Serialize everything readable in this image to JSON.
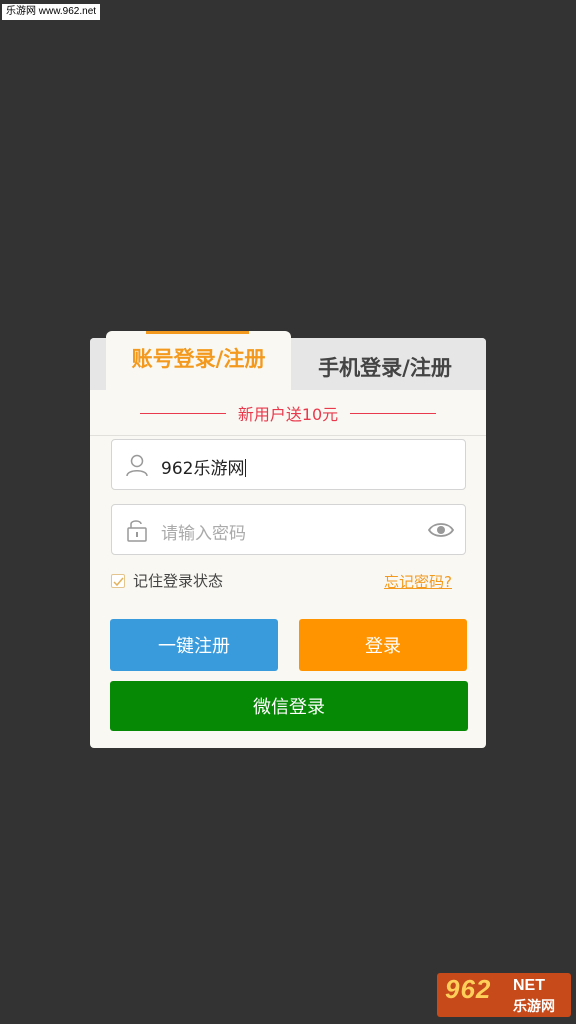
{
  "watermark_top": "乐游网 www.962.net",
  "tabs": {
    "account": "账号登录/注册",
    "phone": "手机登录/注册"
  },
  "promo": "新用户送10元",
  "username": {
    "value": "962乐游网",
    "icon": "user-icon"
  },
  "password": {
    "placeholder": "请输入密码",
    "icon": "lock-icon",
    "toggle_icon": "eye-icon"
  },
  "remember": {
    "label": "记住登录状态",
    "checked": true
  },
  "forgot": "忘记密码?",
  "buttons": {
    "register": "一键注册",
    "login": "登录",
    "wechat": "微信登录"
  },
  "watermark_logo": {
    "number": "962",
    "net": "NET",
    "sub": "乐游网"
  },
  "colors": {
    "accent": "#f39a1e",
    "promo": "#e8394d",
    "register": "#3a9bdc",
    "login": "#ff9400",
    "wechat": "#068a05"
  }
}
